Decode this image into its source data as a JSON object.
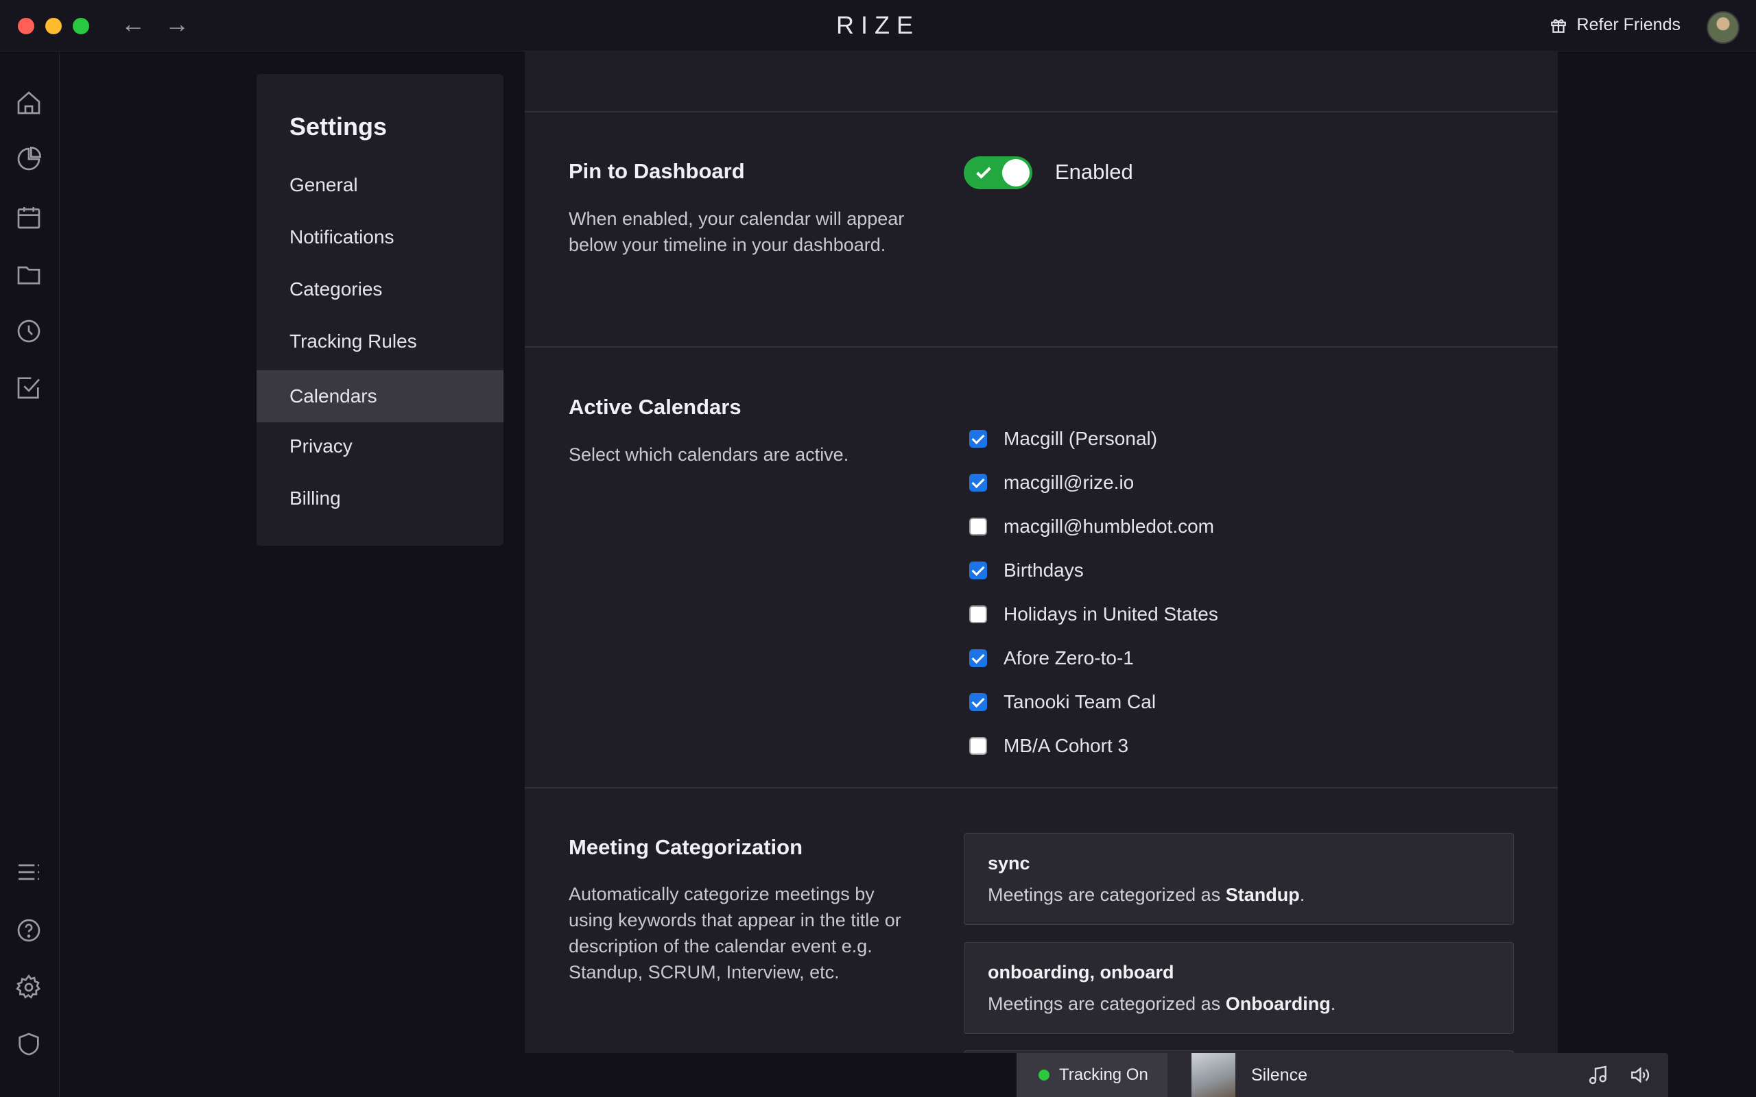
{
  "app": {
    "title": "RIZE",
    "refer_label": "Refer Friends"
  },
  "rail": {
    "items": [
      "home-icon",
      "reports-pie-icon",
      "calendar-icon",
      "folder-icon",
      "clock-icon",
      "tasks-check-icon"
    ],
    "bottom_items": [
      "timeline-list-icon",
      "help-icon",
      "gear-icon",
      "shield-icon"
    ]
  },
  "settings_nav": {
    "title": "Settings",
    "items": [
      {
        "label": "General"
      },
      {
        "label": "Notifications"
      },
      {
        "label": "Categories"
      },
      {
        "label": "Tracking Rules"
      },
      {
        "label": "Calendars",
        "active": true
      },
      {
        "label": "Privacy"
      },
      {
        "label": "Billing"
      }
    ]
  },
  "pin": {
    "title": "Pin to Dashboard",
    "description": "When enabled, your calendar will appear below your timeline in your dashboard.",
    "toggle_on": true,
    "toggle_label": "Enabled"
  },
  "calendars": {
    "title": "Active Calendars",
    "description": "Select which calendars are active.",
    "items": [
      {
        "label": "Macgill (Personal)",
        "checked": true
      },
      {
        "label": "macgill@rize.io",
        "checked": true
      },
      {
        "label": "macgill@humbledot.com",
        "checked": false
      },
      {
        "label": "Birthdays",
        "checked": true
      },
      {
        "label": "Holidays in United States",
        "checked": false
      },
      {
        "label": "Afore Zero-to-1",
        "checked": true
      },
      {
        "label": "Tanooki Team Cal",
        "checked": true
      },
      {
        "label": "MB/A Cohort 3",
        "checked": false
      }
    ]
  },
  "meetings": {
    "title": "Meeting Categorization",
    "description": "Automatically categorize meetings by using keywords that appear in the title or description of the calendar event e.g. Standup, SCRUM, Interview, etc.",
    "rules": [
      {
        "keywords": "sync",
        "prefix": "Meetings are categorized as ",
        "category": "Standup",
        "suffix": "."
      },
      {
        "keywords": "onboarding, onboard",
        "prefix": "Meetings are categorized as ",
        "category": "Onboarding",
        "suffix": "."
      }
    ]
  },
  "player": {
    "tracking_label": "Tracking On",
    "track": "Silence"
  },
  "colors": {
    "accent_green": "#23a83f",
    "checkbox_blue": "#1b74e8",
    "panel": "#1f1e26",
    "background": "#121119"
  }
}
